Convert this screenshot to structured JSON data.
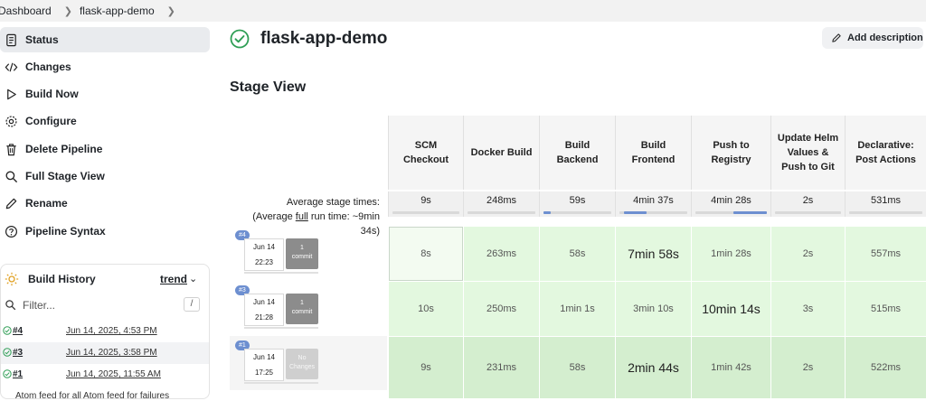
{
  "breadcrumb": {
    "root": "Dashboard",
    "job": "flask-app-demo"
  },
  "sidebar": {
    "items": [
      {
        "label": "Status",
        "icon": "document-icon"
      },
      {
        "label": "Changes",
        "icon": "code-icon"
      },
      {
        "label": "Build Now",
        "icon": "play-icon"
      },
      {
        "label": "Configure",
        "icon": "gear-icon"
      },
      {
        "label": "Delete Pipeline",
        "icon": "trash-icon"
      },
      {
        "label": "Full Stage View",
        "icon": "search-icon"
      },
      {
        "label": "Rename",
        "icon": "pencil-icon"
      },
      {
        "label": "Pipeline Syntax",
        "icon": "help-icon"
      }
    ]
  },
  "history": {
    "title": "Build History",
    "trend": "trend",
    "filter_placeholder": "Filter...",
    "filter_shortcut": "/",
    "builds": [
      {
        "num": "#4",
        "date": "Jun 14, 2025, 4:53 PM"
      },
      {
        "num": "#3",
        "date": "Jun 14, 2025, 3:58 PM"
      },
      {
        "num": "#1",
        "date": "Jun 14, 2025, 11:55 AM"
      }
    ],
    "feeds": "Atom feed for all   Atom feed for failures"
  },
  "job": {
    "title": "flask-app-demo",
    "add_description": "Add description"
  },
  "stage_view": {
    "title": "Stage View",
    "avg_label_1": "Average stage times:",
    "avg_label_2a": "(Average ",
    "avg_label_2b": "full",
    "avg_label_2c": " run time: ~9min",
    "avg_label_3": "34s)",
    "stages": [
      {
        "name": "SCM Checkout",
        "avg": "9s",
        "avg_frac": 0.0
      },
      {
        "name": "Docker Build",
        "avg": "248ms",
        "avg_frac": 0.0
      },
      {
        "name": "Build Backend",
        "avg": "59s",
        "avg_frac": 0.1
      },
      {
        "name": "Build Frontend",
        "avg": "4min 37s",
        "avg_frac": 0.48
      },
      {
        "name": "Push to Registry",
        "avg": "4min 28s",
        "avg_frac": 0.47
      },
      {
        "name": "Update Helm Values & Push to Git",
        "avg": "2s",
        "avg_frac": 0.0
      },
      {
        "name": "Declarative: Post Actions",
        "avg": "531ms",
        "avg_frac": 0.0
      }
    ],
    "runs": [
      {
        "badge": "#4",
        "date": "Jun 14",
        "time": "22:23",
        "changes_1": "1",
        "changes_2": "commit",
        "durations": [
          "8s",
          "263ms",
          "58s",
          "7min 58s",
          "1min 28s",
          "2s",
          "557ms"
        ]
      },
      {
        "badge": "#3",
        "date": "Jun 14",
        "time": "21:28",
        "changes_1": "1",
        "changes_2": "commit",
        "durations": [
          "10s",
          "250ms",
          "1min 1s",
          "3min 10s",
          "10min 14s",
          "3s",
          "515ms"
        ]
      },
      {
        "badge": "#1",
        "date": "Jun 14",
        "time": "17:25",
        "changes_1": "No",
        "changes_2": "Changes",
        "durations": [
          "9s",
          "231ms",
          "58s",
          "2min 44s",
          "1min 42s",
          "2s",
          "522ms"
        ]
      }
    ]
  },
  "colors": {
    "success": "#2f9e55",
    "cell_light": "#e3f8df",
    "cell_dark": "#d4eecf",
    "bar": "#6d8fd0"
  }
}
